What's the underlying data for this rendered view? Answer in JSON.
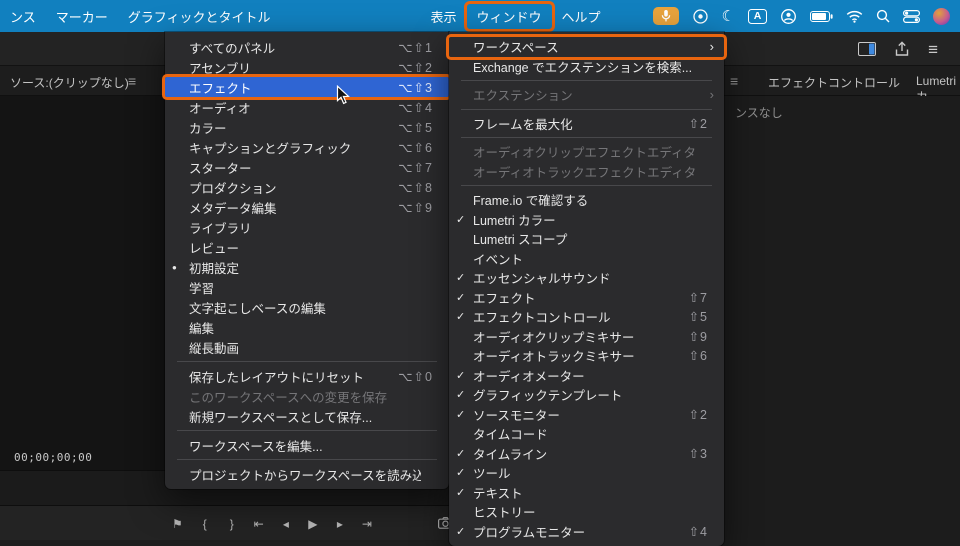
{
  "colors": {
    "menubar_bg": "#1180bf",
    "annotation_orange": "#e8650f",
    "selection_blue": "#2f65d3",
    "mic_badge_bg": "#e8a33c",
    "menu_bg": "#2b2b2d",
    "app_bg": "#1e1e1e"
  },
  "menubar": {
    "items": [
      {
        "label": "ンス",
        "name": "menubar-item-sequence-partial"
      },
      {
        "label": "マーカー",
        "name": "menubar-item-marker"
      },
      {
        "label": "グラフィックとタイトル",
        "name": "menubar-item-graphics-titles"
      },
      {
        "label": "表示",
        "name": "menubar-item-view",
        "gap": true
      },
      {
        "label": "ウィンドウ",
        "name": "menubar-item-window",
        "annotated": true
      },
      {
        "label": "ヘルプ",
        "name": "menubar-item-help"
      }
    ],
    "status_icons": [
      "microphone-in-use-icon",
      "app-swirl-icon",
      "focus-mode-moon-icon",
      "input-source-icon",
      "user-account-icon",
      "battery-icon",
      "wifi-icon",
      "spotlight-search-icon",
      "control-center-icon",
      "user-avatar"
    ]
  },
  "workspace_submenu": {
    "items": [
      {
        "label": "すべてのパネル",
        "shortcut": "⌥⇧1"
      },
      {
        "label": "アセンブリ",
        "shortcut": "⌥⇧2"
      },
      {
        "label": "エフェクト",
        "shortcut": "⌥⇧3",
        "highlighted": true,
        "annotated": true
      },
      {
        "label": "オーディオ",
        "shortcut": "⌥⇧4"
      },
      {
        "label": "カラー",
        "shortcut": "⌥⇧5"
      },
      {
        "label": "キャプションとグラフィック",
        "shortcut": "⌥⇧6"
      },
      {
        "label": "スターター",
        "shortcut": "⌥⇧7"
      },
      {
        "label": "プロダクション",
        "shortcut": "⌥⇧8"
      },
      {
        "label": "メタデータ編集",
        "shortcut": "⌥⇧9"
      },
      {
        "label": "ライブラリ"
      },
      {
        "label": "レビュー"
      },
      {
        "label": "初期設定",
        "radio": true
      },
      {
        "label": "学習"
      },
      {
        "label": "文字起こしベースの編集"
      },
      {
        "label": "編集"
      },
      {
        "label": "縦長動画"
      },
      {
        "type": "sep"
      },
      {
        "label": "保存したレイアウトにリセット",
        "shortcut": "⌥⇧0"
      },
      {
        "label": "このワークスペースへの変更を保存",
        "disabled": true
      },
      {
        "label": "新規ワークスペースとして保存..."
      },
      {
        "type": "sep"
      },
      {
        "label": "ワークスペースを編集..."
      },
      {
        "type": "sep"
      },
      {
        "label": "プロジェクトからワークスペースを読み込み"
      }
    ]
  },
  "window_menu": {
    "items": [
      {
        "label": "ワークスペース",
        "submenu": true,
        "annotated": true
      },
      {
        "label": "Exchange でエクステンションを検索..."
      },
      {
        "type": "sep"
      },
      {
        "label": "エクステンション",
        "submenu": true,
        "disabled": true
      },
      {
        "type": "sep"
      },
      {
        "label": "フレームを最大化",
        "shortcut": "⇧2"
      },
      {
        "type": "sep"
      },
      {
        "label": "オーディオクリップエフェクトエディター",
        "disabled": true
      },
      {
        "label": "オーディオトラックエフェクトエディター",
        "disabled": true
      },
      {
        "type": "sep"
      },
      {
        "label": "Frame.io で確認する"
      },
      {
        "label": "Lumetri カラー",
        "checked": true
      },
      {
        "label": "Lumetri スコープ"
      },
      {
        "label": "イベント"
      },
      {
        "label": "エッセンシャルサウンド",
        "checked": true
      },
      {
        "label": "エフェクト",
        "checked": true,
        "shortcut": "⇧7"
      },
      {
        "label": "エフェクトコントロール",
        "checked": true,
        "shortcut": "⇧5"
      },
      {
        "label": "オーディオクリップミキサー",
        "shortcut": "⇧9"
      },
      {
        "label": "オーディオトラックミキサー",
        "shortcut": "⇧6"
      },
      {
        "label": "オーディオメーター",
        "checked": true
      },
      {
        "label": "グラフィックテンプレート",
        "checked": true
      },
      {
        "label": "ソースモニター",
        "checked": true,
        "shortcut": "⇧2"
      },
      {
        "label": "タイムコード"
      },
      {
        "label": "タイムライン",
        "checked": true,
        "shortcut": "⇧3"
      },
      {
        "label": "ツール",
        "checked": true
      },
      {
        "label": "テキスト",
        "checked": true
      },
      {
        "label": "ヒストリー"
      },
      {
        "label": "プログラムモニター",
        "checked": true,
        "shortcut": "⇧4"
      }
    ]
  },
  "app": {
    "source_panel_tab": "ソース:(クリップなし)",
    "timecode": "00;00;00;00",
    "effect_controls_tab": "エフェクトコントロール",
    "lumetri_tab": "Lumetri カ",
    "no_sequence_text": "ンスなし",
    "transport": [
      {
        "glyph": "⚑",
        "name": "add-marker-icon"
      },
      {
        "glyph": "{",
        "name": "mark-in-icon"
      },
      {
        "glyph": "}",
        "name": "mark-out-icon"
      },
      {
        "glyph": "⇤",
        "name": "go-to-in-icon"
      },
      {
        "glyph": "◂",
        "name": "step-back-icon"
      },
      {
        "glyph": "▶",
        "name": "play-icon"
      },
      {
        "glyph": "▸",
        "name": "step-forward-icon"
      },
      {
        "glyph": "⇥",
        "name": "go-to-out-icon"
      }
    ]
  }
}
